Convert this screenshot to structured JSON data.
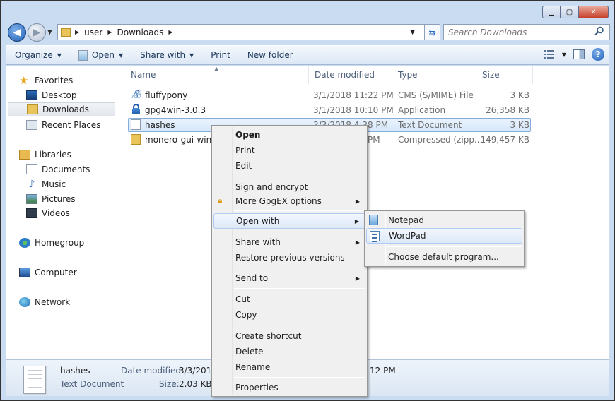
{
  "address": {
    "crumbs": [
      "user",
      "Downloads"
    ]
  },
  "search": {
    "placeholder": "Search Downloads"
  },
  "toolbar": {
    "organize": "Organize",
    "open": "Open",
    "share_with": "Share with",
    "print": "Print",
    "new_folder": "New folder"
  },
  "nav": {
    "favorites": "Favorites",
    "desktop": "Desktop",
    "downloads": "Downloads",
    "recent_places": "Recent Places",
    "libraries": "Libraries",
    "documents": "Documents",
    "music": "Music",
    "pictures": "Pictures",
    "videos": "Videos",
    "homegroup": "Homegroup",
    "computer": "Computer",
    "network": "Network"
  },
  "columns": {
    "name": "Name",
    "date": "Date modified",
    "type": "Type",
    "size": "Size"
  },
  "files": [
    {
      "name": "fluffypony",
      "date": "3/1/2018 11:22 PM",
      "type": "CMS (S/MIME) File",
      "size": "3 KB",
      "icon": "certificate-icon"
    },
    {
      "name": "gpg4win-3.0.3",
      "date": "3/1/2018 10:10 PM",
      "type": "Application",
      "size": "26,358 KB",
      "icon": "lock-icon"
    },
    {
      "name": "hashes",
      "date": "3/3/2018 4:38 PM",
      "type": "Text Document",
      "size": "3 KB",
      "icon": "text-file-icon"
    },
    {
      "name": "monero-gui-win-x64-v0.11.1.0",
      "date": "PM",
      "type": "Compressed (zipp...",
      "size": "149,457 KB",
      "icon": "zip-folder-icon"
    }
  ],
  "details": {
    "name": "hashes",
    "type": "Text Document",
    "date_label": "Date modified:",
    "date_value": "3/3/2018",
    "date_tail": "12 PM",
    "size_label": "Size:",
    "size_value": "2.03 KB"
  },
  "context_menu": {
    "open": "Open",
    "print": "Print",
    "edit": "Edit",
    "sign_encrypt": "Sign and encrypt",
    "more_gpgex": "More GpgEX options",
    "open_with": "Open with",
    "share_with": "Share with",
    "restore": "Restore previous versions",
    "send_to": "Send to",
    "cut": "Cut",
    "copy": "Copy",
    "create_shortcut": "Create shortcut",
    "delete": "Delete",
    "rename": "Rename",
    "properties": "Properties"
  },
  "submenu": {
    "notepad": "Notepad",
    "wordpad": "WordPad",
    "choose_default": "Choose default program..."
  }
}
